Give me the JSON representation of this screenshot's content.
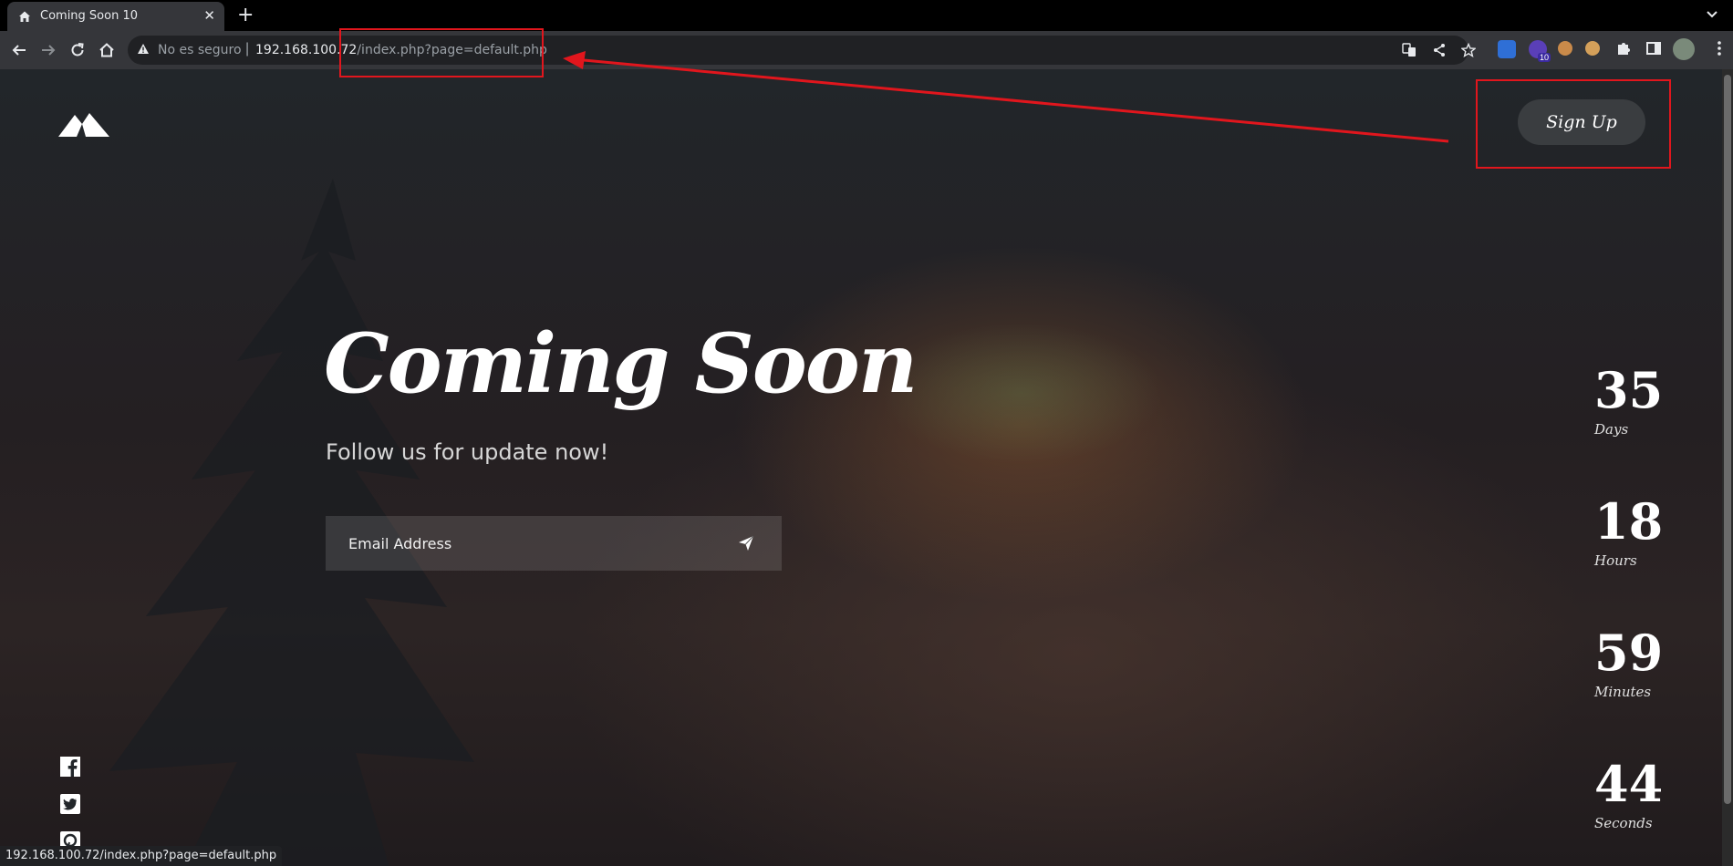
{
  "browser": {
    "tab_title": "Coming Soon 10",
    "tab_close": "✕",
    "new_tab": "+",
    "tab_menu": "⌄",
    "security_label": "No es seguro",
    "url_host": "192.168.100.72",
    "url_path": "/index.php?page=default.php",
    "extension_badge": "10",
    "status_url": "192.168.100.72/index.php?page=default.php"
  },
  "page": {
    "signup_label": "Sign Up",
    "title": "Coming Soon",
    "subtitle": "Follow us for update now!",
    "email_placeholder": "Email Address"
  },
  "countdown": [
    {
      "value": "35",
      "label": "Days"
    },
    {
      "value": "18",
      "label": "Hours"
    },
    {
      "value": "59",
      "label": "Minutes"
    },
    {
      "value": "44",
      "label": "Seconds"
    }
  ],
  "social": [
    "facebook-icon",
    "twitter-icon",
    "pinterest-icon"
  ],
  "colors": {
    "annotation": "#e1161d",
    "tab_bg": "#35363a",
    "omnibox_bg": "#202124"
  }
}
